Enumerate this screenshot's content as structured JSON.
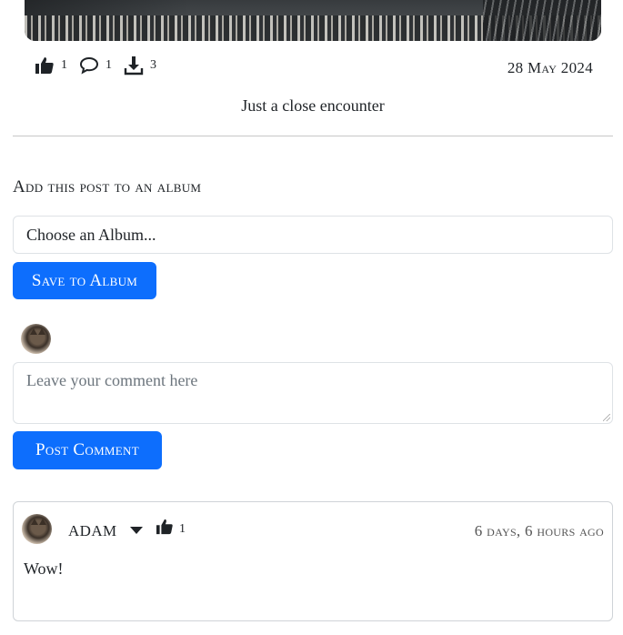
{
  "post": {
    "stats": {
      "likes": "1",
      "comments": "1",
      "downloads": "3"
    },
    "date": "28 May 2024",
    "caption": "Just a close encounter"
  },
  "album": {
    "heading": "Add this post to an album",
    "select_value": "Choose an Album...",
    "save_label": "Save to Album"
  },
  "composer": {
    "placeholder": "Leave your comment here",
    "post_label": "Post Comment"
  },
  "comments": [
    {
      "author": "ADAM",
      "likes": "1",
      "time": "6 days, 6 hours ago",
      "text": "Wow!"
    }
  ],
  "colors": {
    "primary": "#0d6efd",
    "text": "#212529",
    "border": "#dee2e6"
  },
  "icons": [
    "thumbs-up-icon",
    "comment-icon",
    "download-icon",
    "caret-down-icon"
  ]
}
